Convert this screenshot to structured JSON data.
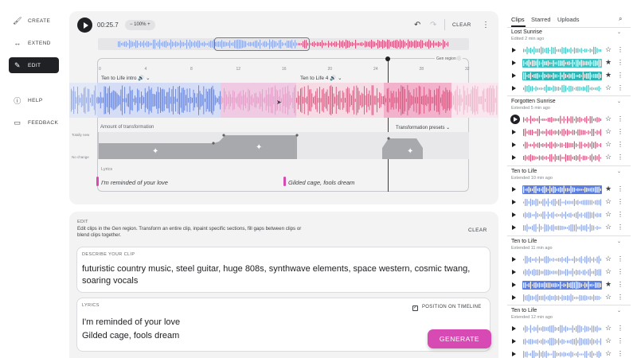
{
  "nav": {
    "create": "CREATE",
    "extend": "EXTEND",
    "edit": "EDIT",
    "help": "HELP",
    "feedback": "FEEDBACK"
  },
  "toolbar": {
    "time": "00:25.7",
    "zoom": "− 100% +",
    "clear": "CLEAR"
  },
  "timeline": {
    "ticks": [
      "0",
      "4",
      "8",
      "12",
      "16",
      "20",
      "24",
      "28",
      "32"
    ],
    "gen_region": "Gen region",
    "clip_a": "Ten to Life intro",
    "clip_b": "Ten to Life 4",
    "transform_title": "Amount of transformation",
    "presets": "Transformation presets",
    "axis_top": "Totally new",
    "axis_bottom": "No change",
    "lyrics_label": "Lyrics",
    "lyric_1": "I'm reminded of your love",
    "lyric_2": "Gilded cage, fools dream"
  },
  "edit_panel": {
    "title": "EDIT",
    "description": "Edit clips in the Gen region. Transform an entire clip, inpaint specific sections, fill gaps between clips or blend clips together.",
    "clear": "CLEAR",
    "describe_label": "DESCRIBE YOUR CLIP",
    "describe_text": "futuristic country music, steel guitar, huge 808s, synthwave elements, space western, cosmic twang, soaring vocals",
    "lyrics_label": "LYRICS",
    "lyrics_line1": "I'm reminded of your love",
    "lyrics_line2": "Gilded cage, fools dream",
    "position_label": "POSITION ON TIMELINE",
    "generate": "GENERATE"
  },
  "sidebar": {
    "tabs": [
      "Clips",
      "Starred",
      "Uploads"
    ],
    "groups": [
      {
        "title": "Lost Sunrise",
        "subtitle": "Edited 2 min ago"
      },
      {
        "title": "Forgotten Sunrise",
        "subtitle": "Extended 5 min ago"
      },
      {
        "title": "Ten to Life",
        "subtitle": "Extended 10 min ago"
      },
      {
        "title": "Ten to Life",
        "subtitle": "Extended 11 min ago"
      },
      {
        "title": "Ten to Life",
        "subtitle": "Extended 12 min ago"
      }
    ]
  },
  "colors": {
    "accent": "#d74ab3",
    "blue": "#6f8fe6",
    "pink": "#d9507a",
    "teal": "#3fc4c4",
    "light_pink": "#e7a6c6",
    "light_blue": "#8ea6e6"
  }
}
